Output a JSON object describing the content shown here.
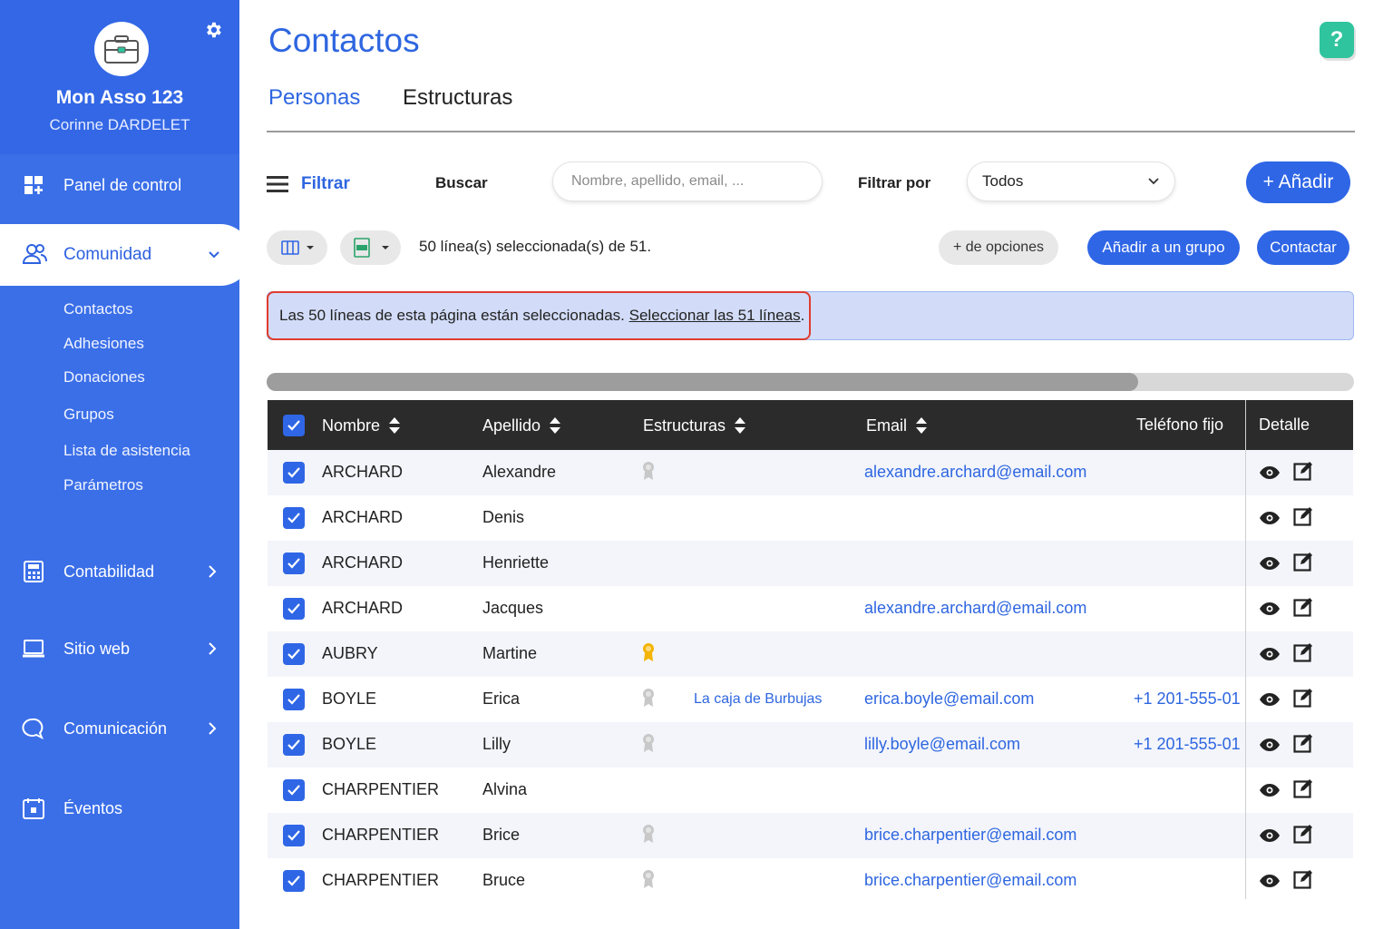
{
  "sidebar": {
    "org_name": "Mon Asso 123",
    "user_name": "Corinne DARDELET",
    "nav": {
      "panel": "Panel de control",
      "comunidad": "Comunidad",
      "contabilidad": "Contabilidad",
      "sitio": "Sitio web",
      "comunicacion": "Comunicación",
      "eventos": "Éventos"
    },
    "sub": [
      "Contactos",
      "Adhesiones",
      "Donaciones",
      "Grupos",
      "Lista de asistencia",
      "Parámetros"
    ]
  },
  "page": {
    "title": "Contactos",
    "help": "?",
    "tabs": [
      "Personas",
      "Estructuras"
    ]
  },
  "toolbar": {
    "filter": "Filtrar",
    "search_label": "Buscar",
    "search_placeholder": "Nombre, apellido, email, ...",
    "filter_by": "Filtrar por",
    "filter_value": "Todos",
    "add": "+ Añadir",
    "selected_text": "50 línea(s) seleccionada(s) de 51.",
    "more_options": "+ de opciones",
    "add_group": "Añadir a un grupo",
    "contact": "Contactar"
  },
  "banner": {
    "text": "Las 50 líneas de esta página están seleccionadas.",
    "link": "Seleccionar las 51 líneas",
    "end": "."
  },
  "scroll": {
    "position": 0.8
  },
  "table": {
    "headers": {
      "nombre": "Nombre",
      "apellido": "Apellido",
      "estructuras": "Estructuras",
      "email": "Email",
      "telefono": "Teléfono fijo",
      "detalle": "Detalle"
    },
    "rows": [
      {
        "nombre": "ARCHARD",
        "apellido": "Alexandre",
        "medal": "gray",
        "estructura": "",
        "email": "alexandre.archard@email.com",
        "telefono": ""
      },
      {
        "nombre": "ARCHARD",
        "apellido": "Denis",
        "medal": "",
        "estructura": "",
        "email": "",
        "telefono": ""
      },
      {
        "nombre": "ARCHARD",
        "apellido": "Henriette",
        "medal": "",
        "estructura": "",
        "email": "",
        "telefono": ""
      },
      {
        "nombre": "ARCHARD",
        "apellido": "Jacques",
        "medal": "",
        "estructura": "",
        "email": "alexandre.archard@email.com",
        "telefono": ""
      },
      {
        "nombre": "AUBRY",
        "apellido": "Martine",
        "medal": "gold",
        "estructura": "",
        "email": "",
        "telefono": ""
      },
      {
        "nombre": "BOYLE",
        "apellido": "Erica",
        "medal": "gray",
        "estructura": "La caja de Burbujas",
        "email": "erica.boyle@email.com",
        "telefono": "+1 201-555-01"
      },
      {
        "nombre": "BOYLE",
        "apellido": "Lilly",
        "medal": "gray",
        "estructura": "",
        "email": "lilly.boyle@email.com",
        "telefono": "+1 201-555-01"
      },
      {
        "nombre": "CHARPENTIER",
        "apellido": "Alvina",
        "medal": "",
        "estructura": "",
        "email": "",
        "telefono": ""
      },
      {
        "nombre": "CHARPENTIER",
        "apellido": "Brice",
        "medal": "gray",
        "estructura": "",
        "email": "brice.charpentier@email.com",
        "telefono": ""
      },
      {
        "nombre": "CHARPENTIER",
        "apellido": "Bruce",
        "medal": "gray",
        "estructura": "",
        "email": "brice.charpentier@email.com",
        "telefono": ""
      }
    ]
  },
  "colors": {
    "primary": "#2f66e6",
    "sidebar": "#3b6fe8",
    "help": "#2fc49d",
    "highlight": "#e03b2f",
    "medal_gold": "#f4b400",
    "medal_gray": "#c8c8c8"
  }
}
